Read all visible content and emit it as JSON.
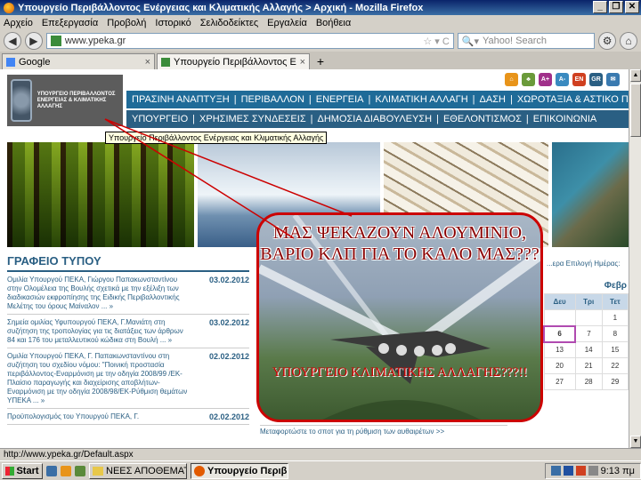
{
  "window": {
    "title": "Υπουργείο Περιβάλλοντος Ενέργειας και Κλιματικής Αλλαγής > Αρχική - Mozilla Firefox",
    "controls": [
      "_",
      "❐",
      "✕"
    ]
  },
  "menu": [
    "Αρχείο",
    "Επεξεργασία",
    "Προβολή",
    "Ιστορικό",
    "Σελιδοδείκτες",
    "Εργαλεία",
    "Βοήθεια"
  ],
  "navbar": {
    "back": "◀",
    "forward": "▶",
    "url": "www.ypeka.gr",
    "search_placeholder": "Yahoo! Search"
  },
  "tabs": [
    {
      "label": "Google",
      "active": false
    },
    {
      "label": "Υπουργείο Περιβάλλοντος Ενέρ...",
      "active": true
    }
  ],
  "site": {
    "logo_text": "ΥΠΟΥΡΓΕΙΟ ΠΕΡΙΒΑΛΛΟΝΤΟΣ ΕΝΕΡΓΕΙΑΣ & ΚΛΙΜΑΤΙΚΗΣ ΑΛΛΑΓΗΣ",
    "top_icons": [
      "⌂",
      "♣",
      "A+",
      "A-",
      "EN",
      "GR",
      "✉"
    ],
    "nav_primary": [
      "ΠΡΑΣΙΝΗ ΑΝΑΠΤΥΞΗ",
      "ΠΕΡΙΒΑΛΛΟΝ",
      "ΕΝΕΡΓΕΙΑ",
      "ΚΛΙΜΑΤΙΚΗ ΑΛΛΑΓΗ",
      "ΔΑΣΗ",
      "ΧΩΡΟΤΑΞΙΑ & ΑΣΤΙΚΟ ΠΕΡΙΒΑΛ"
    ],
    "nav_secondary": [
      "ΥΠΟΥΡΓΕΙΟ",
      "ΧΡΗΣΙΜΕΣ ΣΥΝΔΕΣΕΙΣ",
      "ΔΗΜΟΣΙΑ ΔΙΑΒΟΥΛΕΥΣΗ",
      "ΕΘΕΛΟΝΤΙΣΜΟΣ",
      "ΕΠΙΚΟΙΝΩΝΙΑ"
    ],
    "tooltip": "Υπουργείο Περιβάλλοντος Ενέργειας και Κλιματικής Αλλαγής",
    "press": {
      "heading": "ΓΡΑΦΕΙΟ ΤΥΠΟΥ",
      "items": [
        {
          "text": "Ομιλία Υπουργού ΠΕΚΑ, Γιώργου Παπακωνσταντίνου στην Ολομέλεια της Βουλής σχετικά με την εξέλιξη των διαδικασιών εκφροπίησης της Ειδικής Περιβαλλοντικής Μελέτης του όρους Μαίναλον ... »",
          "date": "03.02.2012"
        },
        {
          "text": "Σημεία ομιλίας Υφυπουργού ΠΕΚΑ, Γ.Μανιάτη στη συζήτηση της τροπολογίας για τις διατάξεις των άρθρων 84 και 176 του μεταλλευτικού κώδικα στη Βουλή ... »",
          "date": "03.02.2012"
        },
        {
          "text": "Ομιλία Υπουργού ΠΕΚΑ, Γ. Παπακωνσταντίνου στη συζήτηση του σχεδίου νόμου: \"Ποινική προστασία περιβάλλοντος-Εναρμόνιση με την οδηγία 2008/99 /ΕΚ-Πλαίσιο παραγωγής και διαχείρισης αποβλήτων-Εναρμόνιση με την οδηγία 2008/98/ΕΚ-Ρύθμιση θεμάτων ΥΠΕΚΑ ... »",
          "date": "02.02.2012"
        },
        {
          "text": "Προϋπολογισμός του Υπουργού ΠΕΚΑ, Γ.",
          "date": "02.02.2012"
        }
      ]
    },
    "calendar_menu": "...ερα  Επιλογή Ημέρας:",
    "calendar": {
      "month": "Φεβρ",
      "headers": [
        "Δευ",
        "Τρι",
        "Τετ"
      ],
      "rows": [
        [
          "",
          "",
          "1"
        ],
        [
          "6",
          "7",
          "8"
        ],
        [
          "13",
          "14",
          "15"
        ],
        [
          "20",
          "21",
          "22"
        ],
        [
          "27",
          "28",
          "29"
        ]
      ]
    },
    "note": "Μεταφορτώστε το σποτ για τη ρύθμιση των αυθαιρέτων >>"
  },
  "overlay": {
    "headline": "ΜΑΣ ΨΕΚΑΖΟΥΝ ΑΛΟΥΜΙΝΙΟ, ΒΑΡΙΟ ΚΛΠ ΓΙΑ ΤΟ ΚΑΛΟ ΜΑΣ???",
    "subline": "ΥΠΟΥΡΓΕΙΟ ΚΛΙΜΑΤΙΚΗΣ ΑΛΛΑΓΗΣ???!!"
  },
  "status": "http://www.ypeka.gr/Default.aspx",
  "taskbar": {
    "start": "Start",
    "tasks": [
      {
        "label": "ΝΕΕΣ ΑΠΟΘΕΜΑΤΩ...",
        "active": false
      },
      {
        "label": "Υπουργείο Περιβ...",
        "active": true
      }
    ],
    "clock": "9:13 πμ"
  },
  "colors": {
    "nav_primary": "#1f6b98",
    "nav_secondary": "#2a5f83",
    "overlay_border": "#cc0000"
  }
}
